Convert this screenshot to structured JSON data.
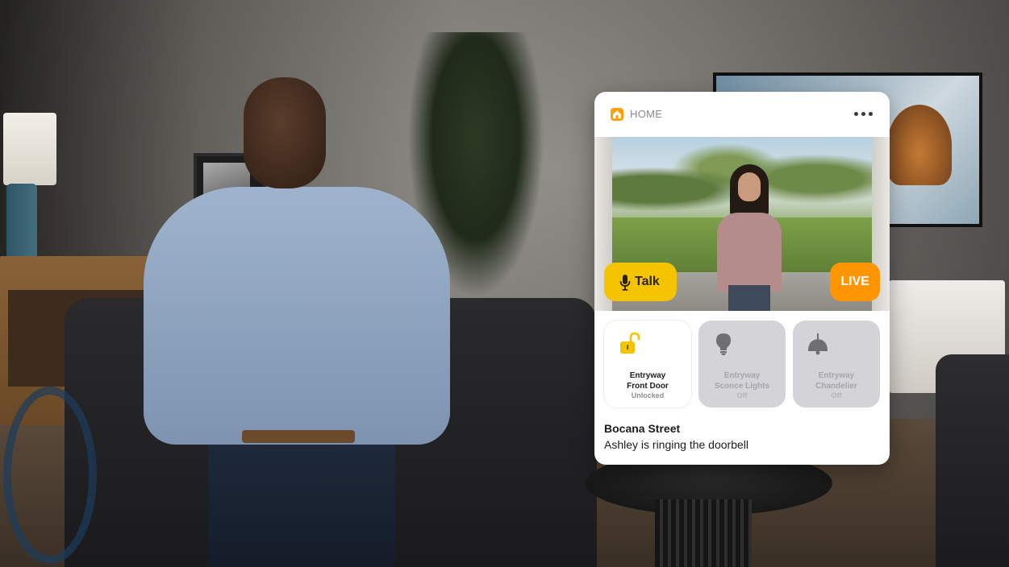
{
  "home_card": {
    "header_label": "HOME",
    "colors": {
      "accent": "#f5c400",
      "live": "#ff9500"
    },
    "camera": {
      "talk_label": "Talk",
      "live_label": "LIVE"
    },
    "accessories": [
      {
        "name_line1": "Entryway",
        "name_line2": "Front Door",
        "status": "Unlocked",
        "icon": "unlocked-padlock-icon",
        "state": "on"
      },
      {
        "name_line1": "Entryway",
        "name_line2": "Sconce Lights",
        "status": "Off",
        "icon": "lightbulb-icon",
        "state": "off"
      },
      {
        "name_line1": "Entryway",
        "name_line2": "Chandelier",
        "status": "Off",
        "icon": "chandelier-icon",
        "state": "off"
      }
    ],
    "notification": {
      "location": "Bocana Street",
      "message": "Ashley is ringing the doorbell"
    }
  }
}
